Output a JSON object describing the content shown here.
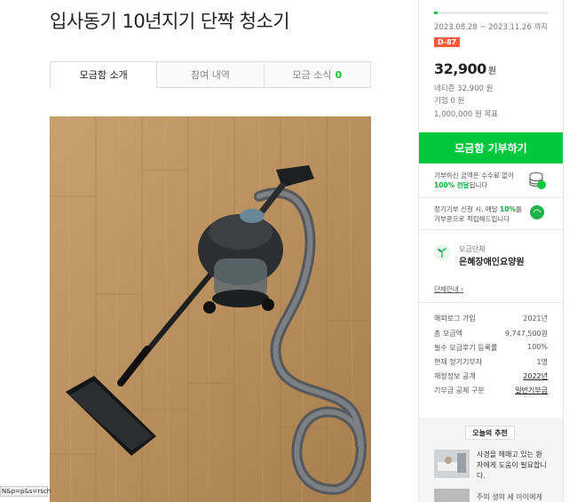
{
  "page": {
    "title": "입사동기 10년지기 단짝 청소기"
  },
  "tabs": [
    {
      "label": "모금함 소개"
    },
    {
      "label": "참여 내역"
    },
    {
      "label": "모금 소식",
      "count": "0"
    }
  ],
  "photo": {
    "alt": "vacuum-cleaner-photo"
  },
  "campaign": {
    "progress_fraction": 0.03,
    "period": "2023.08.28 ~ 2023.11.26 까지",
    "dday": "D-87",
    "amount": "32,900",
    "amount_unit": "원",
    "netizen": "네티즌 32,900 원",
    "company": "기업 0 원",
    "goal": "1,000,000 원 목표"
  },
  "donate_button": {
    "label": "모금함 기부하기"
  },
  "info": {
    "line1a": "기부하신 금액은 수수료 없이",
    "line1b_bold": "100% 전달",
    "line1b_rest": "됩니다",
    "line2a": "정기기부 신청 시, 매달 ",
    "line2a_bold": "10%",
    "line2a_rest": "를",
    "line2b": "기부콩으로 적립해드립니다"
  },
  "org": {
    "label": "모금단체",
    "name": "은혜장애인요양원",
    "link": "단체안내 ›"
  },
  "stats": [
    {
      "k": "해피로그 가입",
      "v": "2021년"
    },
    {
      "k": "총 모금액",
      "v": "9,747,500원"
    },
    {
      "k": "필수 모금후기 등록률",
      "v": "100%"
    },
    {
      "k": "현재 정기기부자",
      "v": "1명"
    },
    {
      "k": "재정정보 공개",
      "v": "2022년"
    },
    {
      "k": "기부금 공제 구분",
      "v": "일반기부금"
    }
  ],
  "recommend": {
    "title": "오늘의 추천",
    "item1": "사경을 헤매고 있는 환자에게 도움이 필요합니다.",
    "item2": "주의 생의 세 아이에게"
  },
  "statusbar": {
    "text": "N&p=p&s=rsch"
  },
  "colors": {
    "accent": "#00c73c",
    "dday": "#ff5a3c"
  }
}
